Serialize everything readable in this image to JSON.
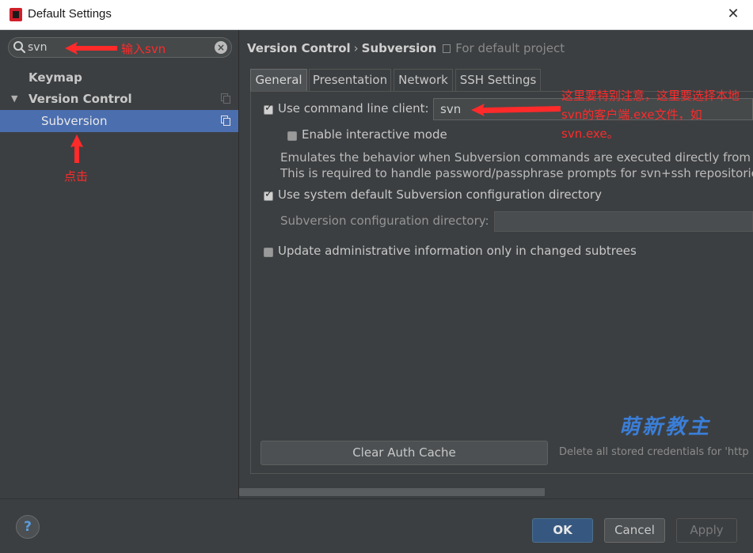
{
  "window": {
    "title": "Default Settings"
  },
  "sidebar": {
    "search_value": "svn",
    "items": [
      {
        "label": "Keymap"
      },
      {
        "label": "Version Control"
      },
      {
        "label": "Subversion"
      }
    ]
  },
  "breadcrumb": {
    "parent": "Version Control",
    "separator": "›",
    "current": "Subversion",
    "scope": "For default project"
  },
  "tabs": [
    "General",
    "Presentation",
    "Network",
    "SSH Settings"
  ],
  "general": {
    "use_cmd_client_label": "Use command line client:",
    "use_cmd_client_checked": true,
    "cmd_client_value": "svn",
    "interactive_label": "Enable interactive mode",
    "interactive_checked": false,
    "desc_line1": "Emulates the behavior when Subversion commands are executed directly from the",
    "desc_line2": "This is required to handle password/passphrase prompts for svn+ssh repositories,",
    "use_sys_default_label": "Use system default Subversion configuration directory",
    "use_sys_default_checked": true,
    "config_dir_label": "Subversion configuration directory:",
    "update_admin_label": "Update administrative information only in changed subtrees",
    "update_admin_checked": false,
    "clear_cache_label": "Clear Auth Cache",
    "clear_cache_desc": "Delete all stored credentials for 'http"
  },
  "buttons": {
    "ok": "OK",
    "cancel": "Cancel",
    "apply": "Apply",
    "help": "?"
  },
  "annotations": {
    "search_note": "输入svn",
    "click_note": "点击",
    "client_note": "这里要特别注意，这里要选择本地svn的客户端.exe文件，如svn.exe。",
    "watermark": "萌新教主"
  },
  "colors": {
    "accent_selection": "#4b6eaf",
    "annotation_red": "#ff2a2a",
    "watermark_blue": "#3a7ed8"
  }
}
